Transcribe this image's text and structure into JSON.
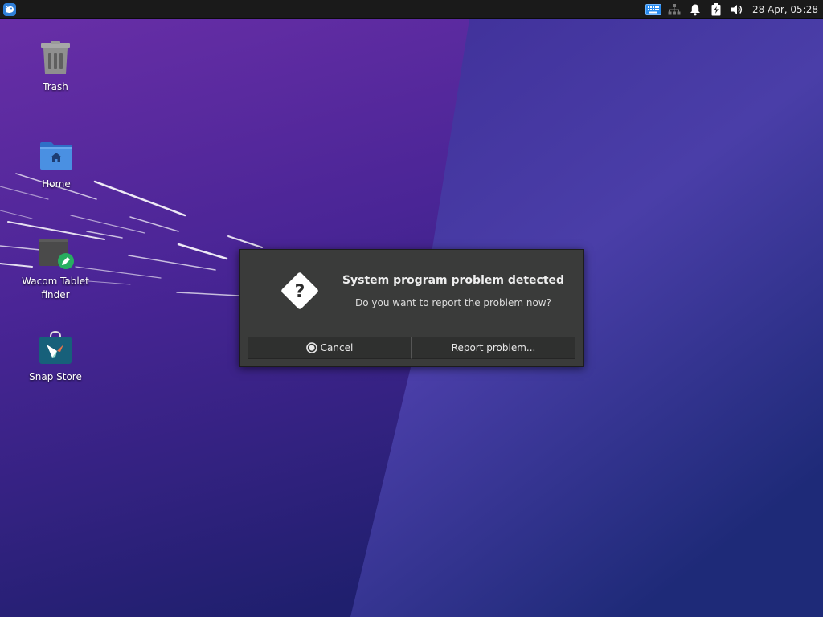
{
  "panel": {
    "whisker_menu_icon": "xfce-mouse-icon",
    "tray_icons": [
      "keyboard-icon",
      "network-icon",
      "notification-bell-icon",
      "battery-charging-icon",
      "volume-icon"
    ],
    "clock": "28 Apr, 05:28"
  },
  "desktop": {
    "icons": [
      {
        "label": "Trash",
        "icon": "trash-icon"
      },
      {
        "label": "Home",
        "icon": "home-folder-icon"
      },
      {
        "label": "Wacom Tablet finder",
        "icon": "wacom-tablet-icon"
      },
      {
        "label": "Snap Store",
        "icon": "snap-store-icon"
      }
    ]
  },
  "dialog": {
    "icon": "question-diamond-icon",
    "title": "System program problem detected",
    "message": "Do you want to report the problem now?",
    "cancel_label": "Cancel",
    "report_label": "Report problem..."
  },
  "colors": {
    "wallpaper_dark": "#2a1a78",
    "wallpaper_purple": "#6a2fa8",
    "panel_bg": "#1a1a1a",
    "dialog_bg": "#3a3b3a",
    "accent": "#3b8ee0"
  }
}
